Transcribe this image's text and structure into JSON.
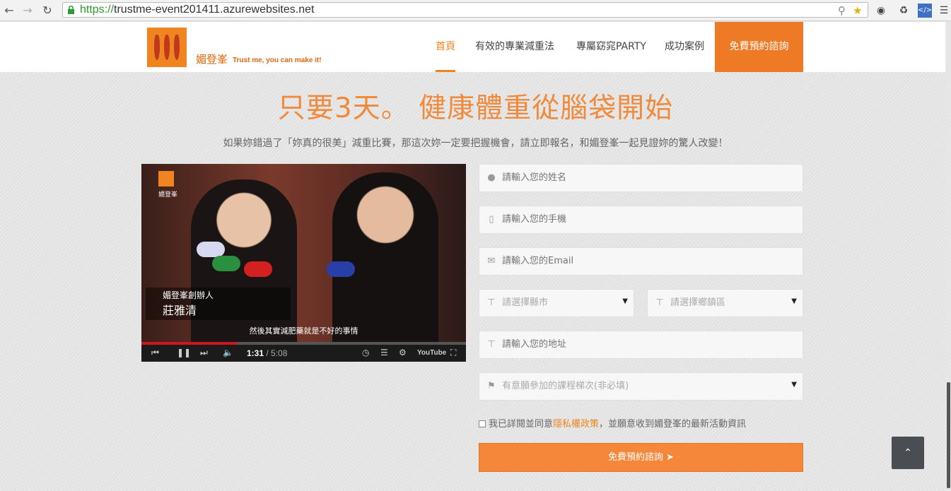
{
  "browser": {
    "url_scheme": "https://",
    "url_rest": "trustme-event201411.azurewebsites.net"
  },
  "brand": {
    "name": "媚登峯",
    "tagline": "Trust me, you can make it!",
    "accent": "#f08420"
  },
  "nav": {
    "items": [
      {
        "label": "首頁",
        "active": true
      },
      {
        "label": "有效的專業減重法"
      },
      {
        "label": "專屬窈窕PARTY"
      },
      {
        "label": "成功案例"
      }
    ],
    "cta": "免費預約諮詢"
  },
  "hero": {
    "title": "只要3天。 健康體重從腦袋開始",
    "subtitle": "如果妳錯過了「妳真的很美」減重比賽，那這次妳一定要把握機會，請立即報名，和媚登峯一起見證妳的驚人改變！"
  },
  "video": {
    "logo_text": "媚登峯",
    "caption_role": "媚登峯創辦人",
    "caption_name": "莊雅清",
    "subtitle": "然後其實減肥藥就是不好的事情",
    "time_current": "1:31",
    "time_total": "/ 5:08",
    "progress": 0.295
  },
  "form": {
    "name_placeholder": "請輸入您的姓名",
    "phone_placeholder": "請輸入您的手機",
    "email_placeholder": "請輸入您的Email",
    "city_placeholder": "請選擇縣市",
    "district_placeholder": "請選擇鄉鎮區",
    "address_placeholder": "請輸入您的地址",
    "course_placeholder": "有意願參加的課程梯次(非必填)",
    "agree_prefix": "我已詳閱並同意",
    "agree_link": "隱私權政策",
    "agree_suffix": "，並願意收到媚登峯的最新活動資訊",
    "submit_label": "免費預約諮詢"
  }
}
